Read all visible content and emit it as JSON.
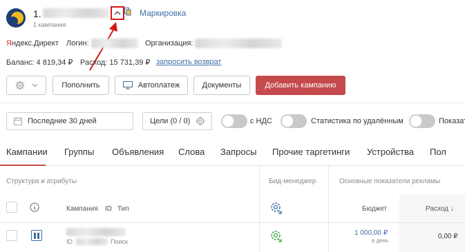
{
  "header": {
    "account_number": "1.",
    "campaign_count": "1 кампания",
    "marking_link": "Маркировка"
  },
  "info": {
    "yandex_direct": "Яндекс.Директ",
    "login_label": "Логин:",
    "org_label": "Организация:",
    "balance": "Баланс: 4 819,34 ₽",
    "expense": "Расход: 15 731,39 ₽",
    "refund_link": "запросить возврат"
  },
  "toolbar": {
    "topup": "Пополнить",
    "autopay": "Автоплатеж",
    "documents": "Документы",
    "add_campaign": "Добавить кампанию"
  },
  "filters": {
    "date_range": "Последние 30 дней",
    "goals": "Цели (0 / 0)",
    "vat": "с НДС",
    "deleted_stats": "Статистика по удалённым",
    "show": "Показать"
  },
  "tabs": [
    "Кампании",
    "Группы",
    "Объявления",
    "Слова",
    "Запросы",
    "Прочие таргетинги",
    "Устройства",
    "Пол"
  ],
  "table": {
    "group_structure": "Структура и атрибуты",
    "group_bid": "Бид-менеджер",
    "group_metrics": "Основные показатели рекламы",
    "col_campaign": "Кампания",
    "col_id": "ID",
    "col_type": "Тип",
    "col_budget": "Бюджет",
    "col_spend": "Расход ↓",
    "row": {
      "id_label": "ID",
      "type": "Поиск",
      "budget": "1 000,00 ₽",
      "budget_period": "в день",
      "spend": "0,00 ₽"
    }
  },
  "colors": {
    "accent_red": "#c54a4d",
    "link_blue": "#3d6ea8",
    "annotation_red": "#d01818",
    "green_gear": "#3aa845"
  }
}
